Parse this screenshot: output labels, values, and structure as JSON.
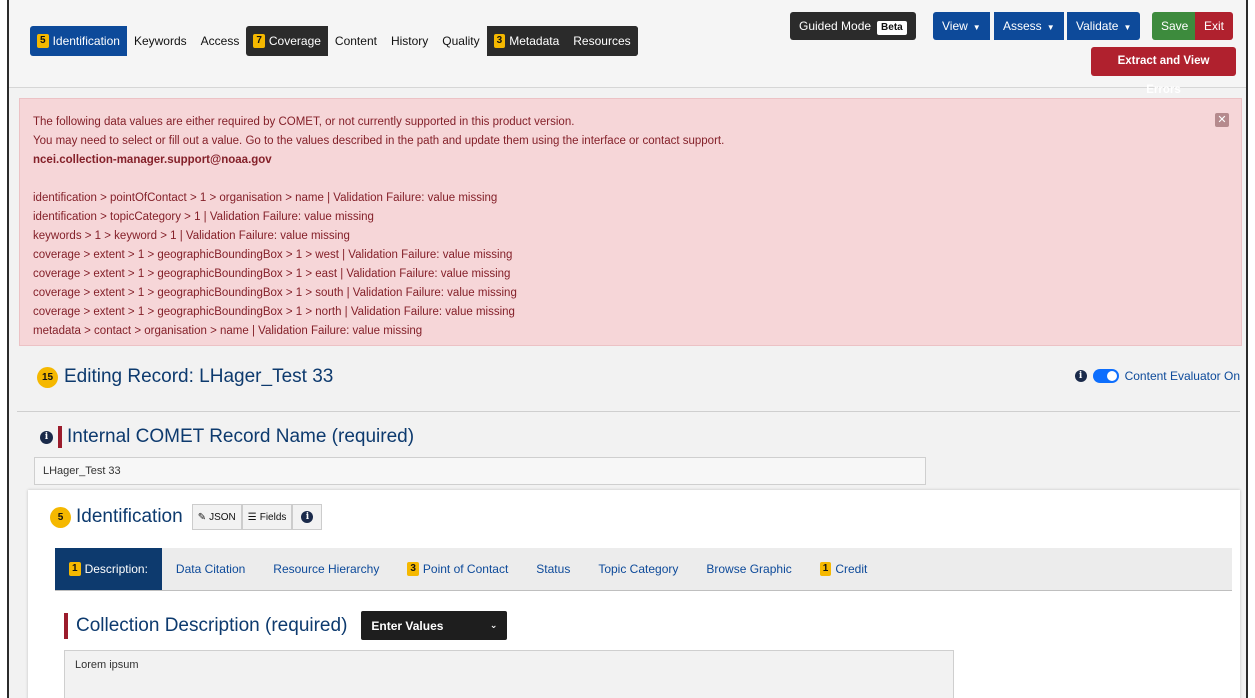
{
  "topnav": {
    "tabs": [
      {
        "badge": "5",
        "label": "Identification"
      },
      {
        "badge": "",
        "label": "Keywords"
      },
      {
        "badge": "",
        "label": "Access"
      },
      {
        "badge": "7",
        "label": "Coverage"
      },
      {
        "badge": "",
        "label": "Content"
      },
      {
        "badge": "",
        "label": "History"
      },
      {
        "badge": "",
        "label": "Quality"
      },
      {
        "badge": "3",
        "label": "Metadata"
      },
      {
        "badge": "",
        "label": "Resources"
      }
    ],
    "guided_mode": "Guided Mode",
    "beta": "Beta",
    "view": "View",
    "assess": "Assess",
    "validate": "Validate",
    "save": "Save",
    "exit": "Exit",
    "extract_errors": "Extract and View Errors"
  },
  "alert": {
    "line1": "The following data values are either required by COMET, or not currently supported in this product version.",
    "line2": "You may need to select or fill out a value. Go to the values described in the path and update them using the interface or contact support.",
    "email": "ncei.collection-manager.support@noaa.gov",
    "errors": [
      "identification > pointOfContact > 1 > organisation > name | Validation Failure: value missing",
      "identification > topicCategory > 1 | Validation Failure: value missing",
      "keywords > 1 > keyword > 1 | Validation Failure: value missing",
      "coverage > extent > 1 > geographicBoundingBox > 1 > west | Validation Failure: value missing",
      "coverage > extent > 1 > geographicBoundingBox > 1 > east | Validation Failure: value missing",
      "coverage > extent > 1 > geographicBoundingBox > 1 > south | Validation Failure: value missing",
      "coverage > extent > 1 > geographicBoundingBox > 1 > north | Validation Failure: value missing",
      "metadata > contact > organisation > name | Validation Failure: value missing"
    ]
  },
  "record": {
    "count": "15",
    "title": "Editing Record: LHager_Test 33",
    "evaluator": "Content Evaluator On"
  },
  "internal_name": {
    "label": "Internal COMET Record Name (required)",
    "value": "LHager_Test 33"
  },
  "identification": {
    "count": "5",
    "title": "Identification",
    "json_btn": "JSON",
    "fields_btn": "Fields",
    "subtabs": [
      {
        "badge": "1",
        "label": "Description:"
      },
      {
        "badge": "",
        "label": "Data Citation"
      },
      {
        "badge": "",
        "label": "Resource Hierarchy"
      },
      {
        "badge": "3",
        "label": "Point of Contact"
      },
      {
        "badge": "",
        "label": "Status"
      },
      {
        "badge": "",
        "label": "Topic Category"
      },
      {
        "badge": "",
        "label": "Browse Graphic"
      },
      {
        "badge": "1",
        "label": "Credit"
      }
    ],
    "desc_label": "Collection Description (required)",
    "select_value": "Enter Values",
    "desc_value": "Lorem ipsum"
  },
  "colors": {
    "primary": "#0d4a9a",
    "dark": "#2b2b2b",
    "save_green": "#3d8b3d",
    "exit_red": "#b0212e",
    "badge_yellow": "#f5b800",
    "alert_bg": "#f6d6d8"
  }
}
